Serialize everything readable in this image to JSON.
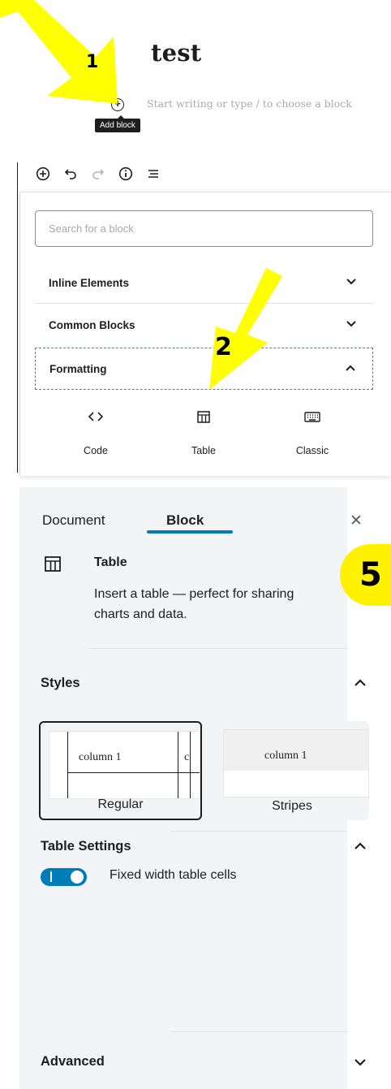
{
  "editor": {
    "title": "test",
    "placeholder": "Start writing or type / to choose a block",
    "add_block_tooltip": "Add block",
    "add_icon": "plus-circle-icon"
  },
  "inserter": {
    "toolbar": {
      "icons": [
        "plus-circle-icon",
        "undo-icon",
        "redo-icon",
        "info-icon",
        "list-view-icon"
      ]
    },
    "search_placeholder": "Search for a block",
    "panels": [
      {
        "label": "Inline Elements",
        "state": "collapsed"
      },
      {
        "label": "Common Blocks",
        "state": "collapsed"
      },
      {
        "label": "Formatting",
        "state": "expanded"
      }
    ],
    "blocks": [
      {
        "label": "Code",
        "icon": "code-icon"
      },
      {
        "label": "Table",
        "icon": "table-icon"
      },
      {
        "label": "Classic",
        "icon": "keyboard-icon"
      }
    ]
  },
  "sidebar": {
    "tabs": [
      {
        "label": "Document",
        "active": false
      },
      {
        "label": "Block",
        "active": true
      }
    ],
    "close_icon": "close-icon",
    "block_card": {
      "name": "Table",
      "description": "Insert a table — perfect for sharing charts and data.",
      "icon": "table-icon"
    },
    "styles": {
      "heading": "Styles",
      "options": [
        {
          "label": "Regular",
          "preview_text": "column 1",
          "selected": true
        },
        {
          "label": "Stripes",
          "preview_text": "column 1",
          "selected": false
        }
      ]
    },
    "table_settings": {
      "heading": "Table Settings",
      "toggle_label": "Fixed width table cells",
      "toggle_on": true
    },
    "advanced": {
      "heading": "Advanced"
    },
    "accent_color": "#007cba"
  },
  "annotations": {
    "arrow_color": "#ffff00",
    "badge_color": "#fff200",
    "step1": "1",
    "step2": "2",
    "step5": "5"
  }
}
